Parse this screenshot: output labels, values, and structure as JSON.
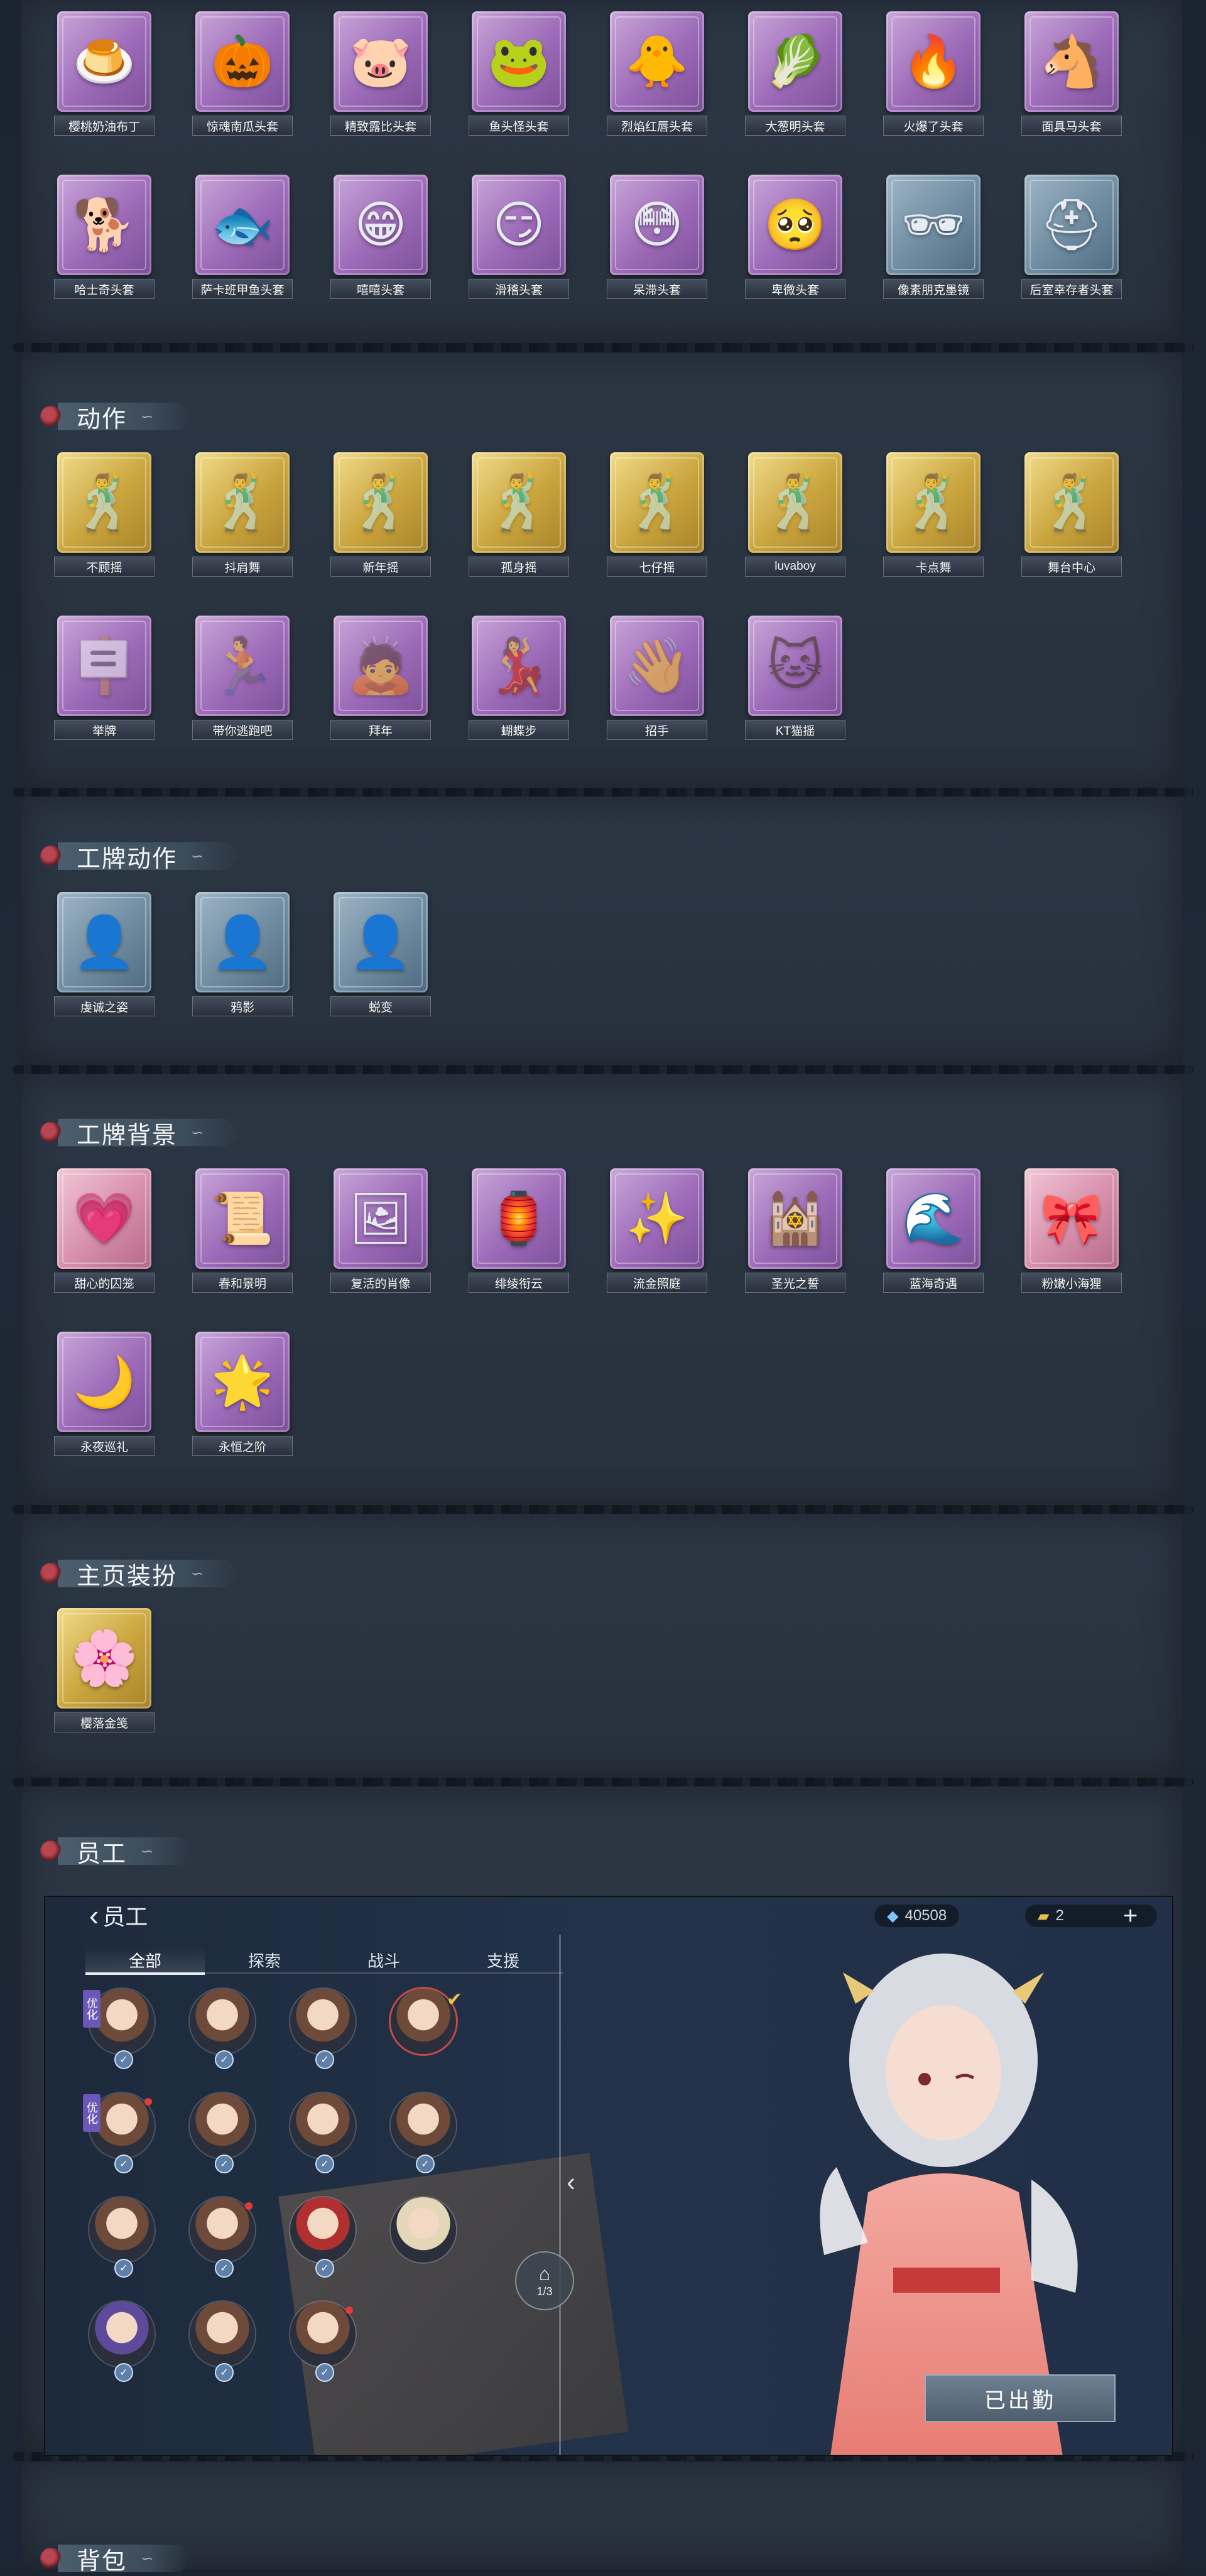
{
  "sections": {
    "mask": {
      "row1": [
        {
          "label": "樱桃奶油布丁",
          "color": "purple",
          "icon": "🍮"
        },
        {
          "label": "惊魂南瓜头套",
          "color": "purple",
          "icon": "🎃"
        },
        {
          "label": "精致露比头套",
          "color": "purple",
          "icon": "🐷"
        },
        {
          "label": "鱼头怪头套",
          "color": "purple",
          "icon": "🐸"
        },
        {
          "label": "烈焰红唇头套",
          "color": "purple",
          "icon": "🐥"
        },
        {
          "label": "大葱明头套",
          "color": "purple",
          "icon": "🥬"
        },
        {
          "label": "火爆了头套",
          "color": "purple",
          "icon": "🔥"
        },
        {
          "label": "面具马头套",
          "color": "purple",
          "icon": "🐴"
        }
      ],
      "row2": [
        {
          "label": "哈士奇头套",
          "color": "purple",
          "icon": "🐕"
        },
        {
          "label": "萨卡班甲鱼头套",
          "color": "purple",
          "icon": "🐟"
        },
        {
          "label": "嘻嘻头套",
          "color": "purple",
          "icon": "😁"
        },
        {
          "label": "滑稽头套",
          "color": "purple",
          "icon": "😏"
        },
        {
          "label": "呆滞头套",
          "color": "purple",
          "icon": "😳"
        },
        {
          "label": "卑微头套",
          "color": "purple",
          "icon": "🥺"
        },
        {
          "label": "像素朋克墨镜",
          "color": "blue",
          "icon": "🕶"
        },
        {
          "label": "后室幸存者头套",
          "color": "blue",
          "icon": "⛑"
        }
      ]
    },
    "action": {
      "title": "动作",
      "items": [
        {
          "label": "不顾摇",
          "color": "gold"
        },
        {
          "label": "抖肩舞",
          "color": "gold"
        },
        {
          "label": "新年摇",
          "color": "gold"
        },
        {
          "label": "孤身摇",
          "color": "gold"
        },
        {
          "label": "七仔摇",
          "color": "gold"
        },
        {
          "label": "luvaboy",
          "color": "gold"
        },
        {
          "label": "卡点舞",
          "color": "gold"
        },
        {
          "label": "舞台中心",
          "color": "gold"
        },
        {
          "label": "举牌",
          "color": "purple"
        },
        {
          "label": "带你逃跑吧",
          "color": "purple"
        },
        {
          "label": "拜年",
          "color": "purple"
        },
        {
          "label": "蝴蝶步",
          "color": "purple"
        },
        {
          "label": "招手",
          "color": "purple"
        },
        {
          "label": "KT猫摇",
          "color": "purple"
        }
      ]
    },
    "badge_action": {
      "title": "工牌动作",
      "items": [
        {
          "label": "虔诚之姿",
          "color": "blue"
        },
        {
          "label": "鸦影",
          "color": "blue"
        },
        {
          "label": "蜕变",
          "color": "blue"
        }
      ]
    },
    "badge_bg": {
      "title": "工牌背景",
      "items": [
        {
          "label": "甜心的囚笼",
          "color": "pink",
          "icon": "💗"
        },
        {
          "label": "春和景明",
          "color": "purple",
          "icon": "📜"
        },
        {
          "label": "复活的肖像",
          "color": "purple",
          "icon": "🖼"
        },
        {
          "label": "绯绫衔云",
          "color": "purple",
          "icon": "🏮"
        },
        {
          "label": "流金照庭",
          "color": "purple",
          "icon": "✨"
        },
        {
          "label": "圣光之誓",
          "color": "purple",
          "icon": "🕍"
        },
        {
          "label": "蓝海奇遇",
          "color": "purple",
          "icon": "🌊"
        },
        {
          "label": "粉嫩小海狸",
          "color": "pink",
          "icon": "🎀"
        },
        {
          "label": "永夜巡礼",
          "color": "purple",
          "icon": "🌙"
        },
        {
          "label": "永恒之阶",
          "color": "purple",
          "icon": "🌟"
        }
      ]
    },
    "home": {
      "title": "主页装扮",
      "items": [
        {
          "label": "樱落金笺",
          "color": "gold",
          "icon": "🌸"
        }
      ]
    },
    "staff": {
      "title": "员工",
      "screen_title": "员工",
      "currency1": "40508",
      "currency2": "2",
      "tabs": [
        "全部",
        "探索",
        "战斗",
        "支援"
      ],
      "active_tab": "全部",
      "badge_text": "优化",
      "map_label": "1/3",
      "dispatch_button": "已出勤"
    },
    "bag": {
      "title": "背包"
    }
  }
}
